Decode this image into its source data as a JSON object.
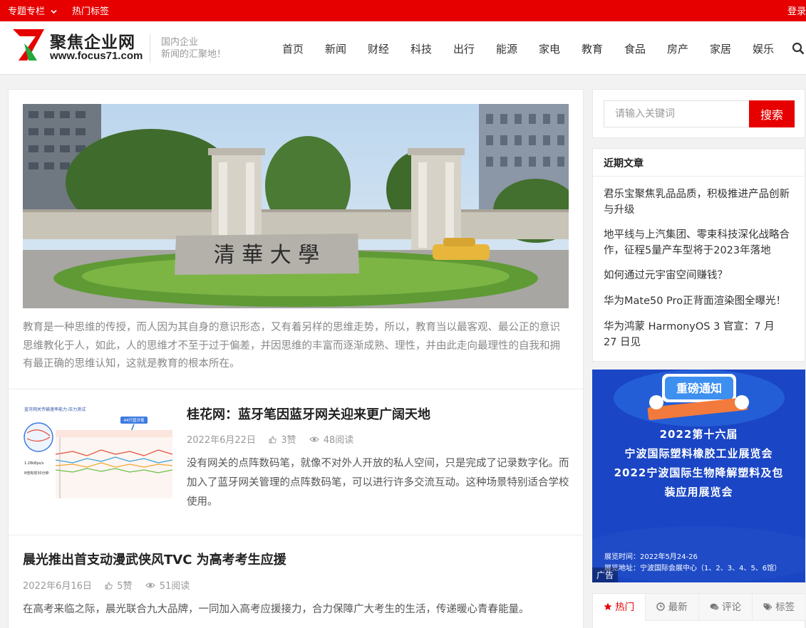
{
  "topbar": {
    "special": "专题专栏",
    "hot_tags": "热门标签",
    "login": "登录"
  },
  "header": {
    "logo_name": "聚焦企业网",
    "logo_url": "www.focus71.com",
    "slogan_line1": "国内企业",
    "slogan_line2": "新闻的汇聚地！",
    "nav": [
      "首页",
      "新闻",
      "财经",
      "科技",
      "出行",
      "能源",
      "家电",
      "教育",
      "食品",
      "房产",
      "家居",
      "娱乐"
    ],
    "brand_red": "#e60000",
    "brand_green": "#22a83c"
  },
  "hero": {
    "gate_inscription": "清 華 大 學",
    "description": "教育是一种思维的传授，而人因为其自身的意识形态，又有着另样的思维走势，所以，教育当以最客观、最公正的意识思维教化于人，如此，人的思维才不至于过于偏差，并因思维的丰富而逐渐成熟、理性，并由此走向最理性的自我和拥有最正确的思维认知，这就是教育的根本所在。"
  },
  "articles": [
    {
      "title": "桂花网：蓝牙笔因蓝牙网关迎来更广阔天地",
      "date": "2022年6月22日",
      "likes": "3赞",
      "views": "48阅读",
      "summary": "没有网关的点阵数码笔，就像不对外人开放的私人空间，只是完成了记录数字化。而加入了蓝牙网关管理的点阵数码笔，可以进行许多交流互动。这种场景特别适合学校使用。",
      "thumb_heading": "蓝牙网关传输速率能力-压力测试",
      "thumb_tag": "44只蓝牙笔",
      "thumb_rate": "1.28kBps/s",
      "thumb_note": "8倍有效30分钟"
    },
    {
      "title": "晨光推出首支动漫武侠风TVC 为高考考生应援",
      "date": "2022年6月16日",
      "likes": "5赞",
      "views": "51阅读",
      "summary": "在高考来临之际，晨光联合九大品牌，一同加入高考应援接力，合力保障广大考生的生活，传递暖心青春能量。"
    }
  ],
  "sidebar": {
    "search_placeholder": "请输入关键词",
    "search_button": "搜索",
    "recent_title": "近期文章",
    "recent": [
      "君乐宝聚焦乳品品质，积极推进产品创新与升级",
      "地平线与上汽集团、零束科技深化战略合作，征程5量产车型将于2023年落地",
      "如何通过元宇宙空间赚钱？",
      "华为Mate50 Pro正背面渲染图全曝光！",
      "华为鸿蒙 HarmonyOS 3 官宣：7 月 27 日见"
    ],
    "ad": {
      "banner_text": "重磅通知",
      "line1": "2022第十六届",
      "line2": "宁波国际塑料橡胶工业展览会",
      "line3": "2022宁波国际生物降解塑料及包",
      "line4": "装应用展览会",
      "time": "展览时间：2022年5月24-26",
      "place": "展览地址：宁波国际会展中心（1、2、3、4、5、6馆）",
      "badge": "广告"
    },
    "tabs": [
      "热门",
      "最新",
      "评论",
      "标签"
    ]
  }
}
